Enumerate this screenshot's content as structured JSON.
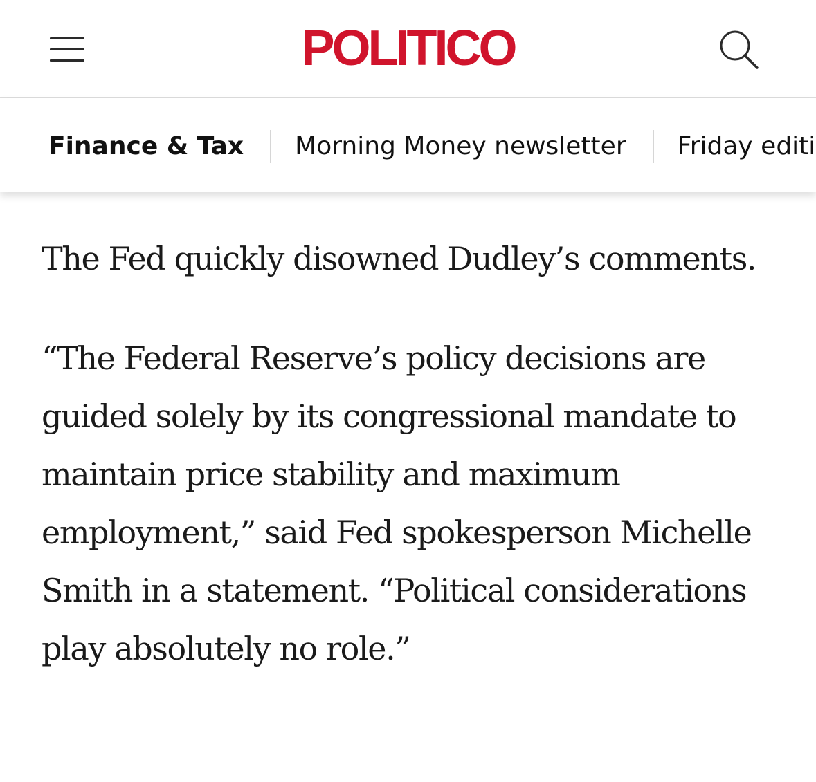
{
  "header": {
    "logo_text": "POLITICO",
    "logo_color": "#d0142c",
    "menu_icon": "hamburger-menu-icon",
    "search_icon": "search-icon"
  },
  "subnav": {
    "items": [
      {
        "label": "Finance & Tax",
        "active": true
      },
      {
        "label": "Morning Money newsletter",
        "active": false
      },
      {
        "label": "Friday edition",
        "active": false
      }
    ]
  },
  "article": {
    "paragraphs": [
      "The Fed quickly disowned Dudley’s comments.",
      "“The Federal Reserve’s policy decisions are guided solely by its congressional mandate to maintain price stability and maximum employment,” said Fed spokesperson Michelle Smith in a statement. “Political considerations play absolutely no role.”"
    ]
  }
}
